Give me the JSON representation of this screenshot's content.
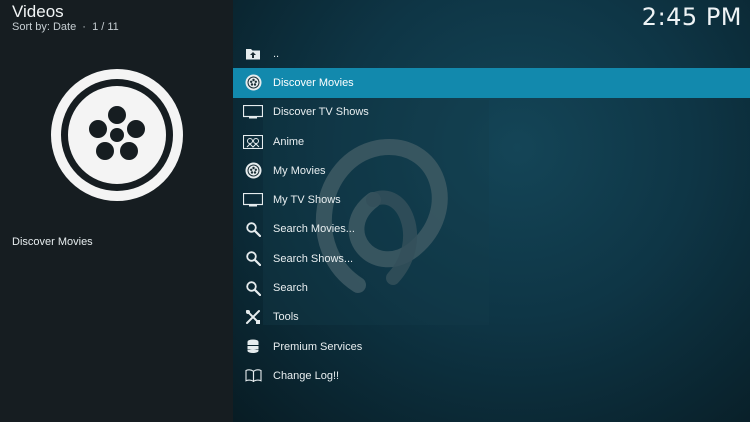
{
  "header": {
    "title": "Videos",
    "sort_text": "Sort by: Date  ·  1 / 11"
  },
  "clock": "2:45 PM",
  "selected_item_label": "Discover Movies",
  "colors": {
    "selection": "#1289ad",
    "left_panel": "#161d21",
    "background": "#0e3545"
  },
  "menu": {
    "items": [
      {
        "label": "..",
        "icon": "folder-up-icon"
      },
      {
        "label": "Discover Movies",
        "icon": "film-reel-icon",
        "selected": true
      },
      {
        "label": "Discover TV Shows",
        "icon": "tv-icon"
      },
      {
        "label": "Anime",
        "icon": "anime-icon"
      },
      {
        "label": "My Movies",
        "icon": "film-reel-icon"
      },
      {
        "label": "My TV Shows",
        "icon": "tv-icon"
      },
      {
        "label": "Search Movies...",
        "icon": "search-icon"
      },
      {
        "label": "Search Shows...",
        "icon": "search-icon"
      },
      {
        "label": "Search",
        "icon": "search-icon"
      },
      {
        "label": "Tools",
        "icon": "tools-icon"
      },
      {
        "label": "Premium Services",
        "icon": "database-icon"
      },
      {
        "label": "Change Log!!",
        "icon": "book-icon"
      }
    ]
  }
}
